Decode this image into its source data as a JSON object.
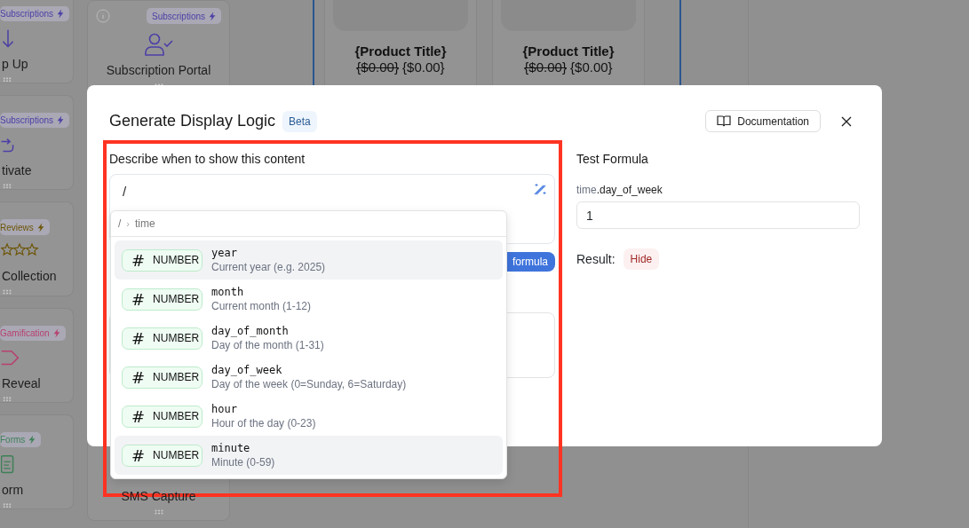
{
  "background": {
    "left_cards": [
      {
        "badge": "Subscriptions",
        "color": "#4b3fa6",
        "title": "p Up"
      },
      {
        "badge": "Subscriptions",
        "color": "#4b3fa6",
        "title": "tivate"
      },
      {
        "badge": "Reviews",
        "color": "#6e5608",
        "title": "Collection"
      },
      {
        "badge": "Gamification",
        "color": "#b83f6e",
        "title": "Reveal"
      },
      {
        "badge": "Forms",
        "color": "#3f8058",
        "title": "orm"
      }
    ],
    "middle_cards": [
      {
        "badge": "Subscriptions",
        "color": "#4b3fa6",
        "title": "Subscription Portal"
      },
      {
        "title": "SMS Capture"
      }
    ],
    "products": [
      {
        "title": "{Product Title}",
        "old_price": "{$0.00}",
        "price": "{$0.00}"
      },
      {
        "title": "{Product Title}",
        "old_price": "{$0.00}",
        "price": "{$0.00}"
      }
    ]
  },
  "dialog": {
    "title": "Generate Display Logic",
    "badge": "Beta",
    "documentation_button": "Documentation",
    "prompt_label": "Describe when to show this content",
    "prompt_value": "/",
    "generate_button": "formula",
    "menu": {
      "path_root": "/",
      "path_separator": "›",
      "path_current": "time",
      "items": [
        {
          "type": "NUMBER",
          "type_icon": "#",
          "name": "year",
          "description": "Current year (e.g. 2025)",
          "highlighted": true
        },
        {
          "type": "NUMBER",
          "type_icon": "#",
          "name": "month",
          "description": "Current month (1-12)",
          "highlighted": false
        },
        {
          "type": "NUMBER",
          "type_icon": "#",
          "name": "day_of_month",
          "description": "Day of the month (1-31)",
          "highlighted": false
        },
        {
          "type": "NUMBER",
          "type_icon": "#",
          "name": "day_of_week",
          "description": "Day of the week (0=Sunday, 6=Saturday)",
          "highlighted": false
        },
        {
          "type": "NUMBER",
          "type_icon": "#",
          "name": "hour",
          "description": "Hour of the day (0-23)",
          "highlighted": false
        },
        {
          "type": "NUMBER",
          "type_icon": "#",
          "name": "minute",
          "description": "Minute (0-59)",
          "highlighted": true
        }
      ]
    },
    "test": {
      "heading": "Test Formula",
      "variable_prefix": "time",
      "variable_name": ".day_of_week",
      "value": "1",
      "result_label": "Result:",
      "result": "Hide"
    }
  }
}
